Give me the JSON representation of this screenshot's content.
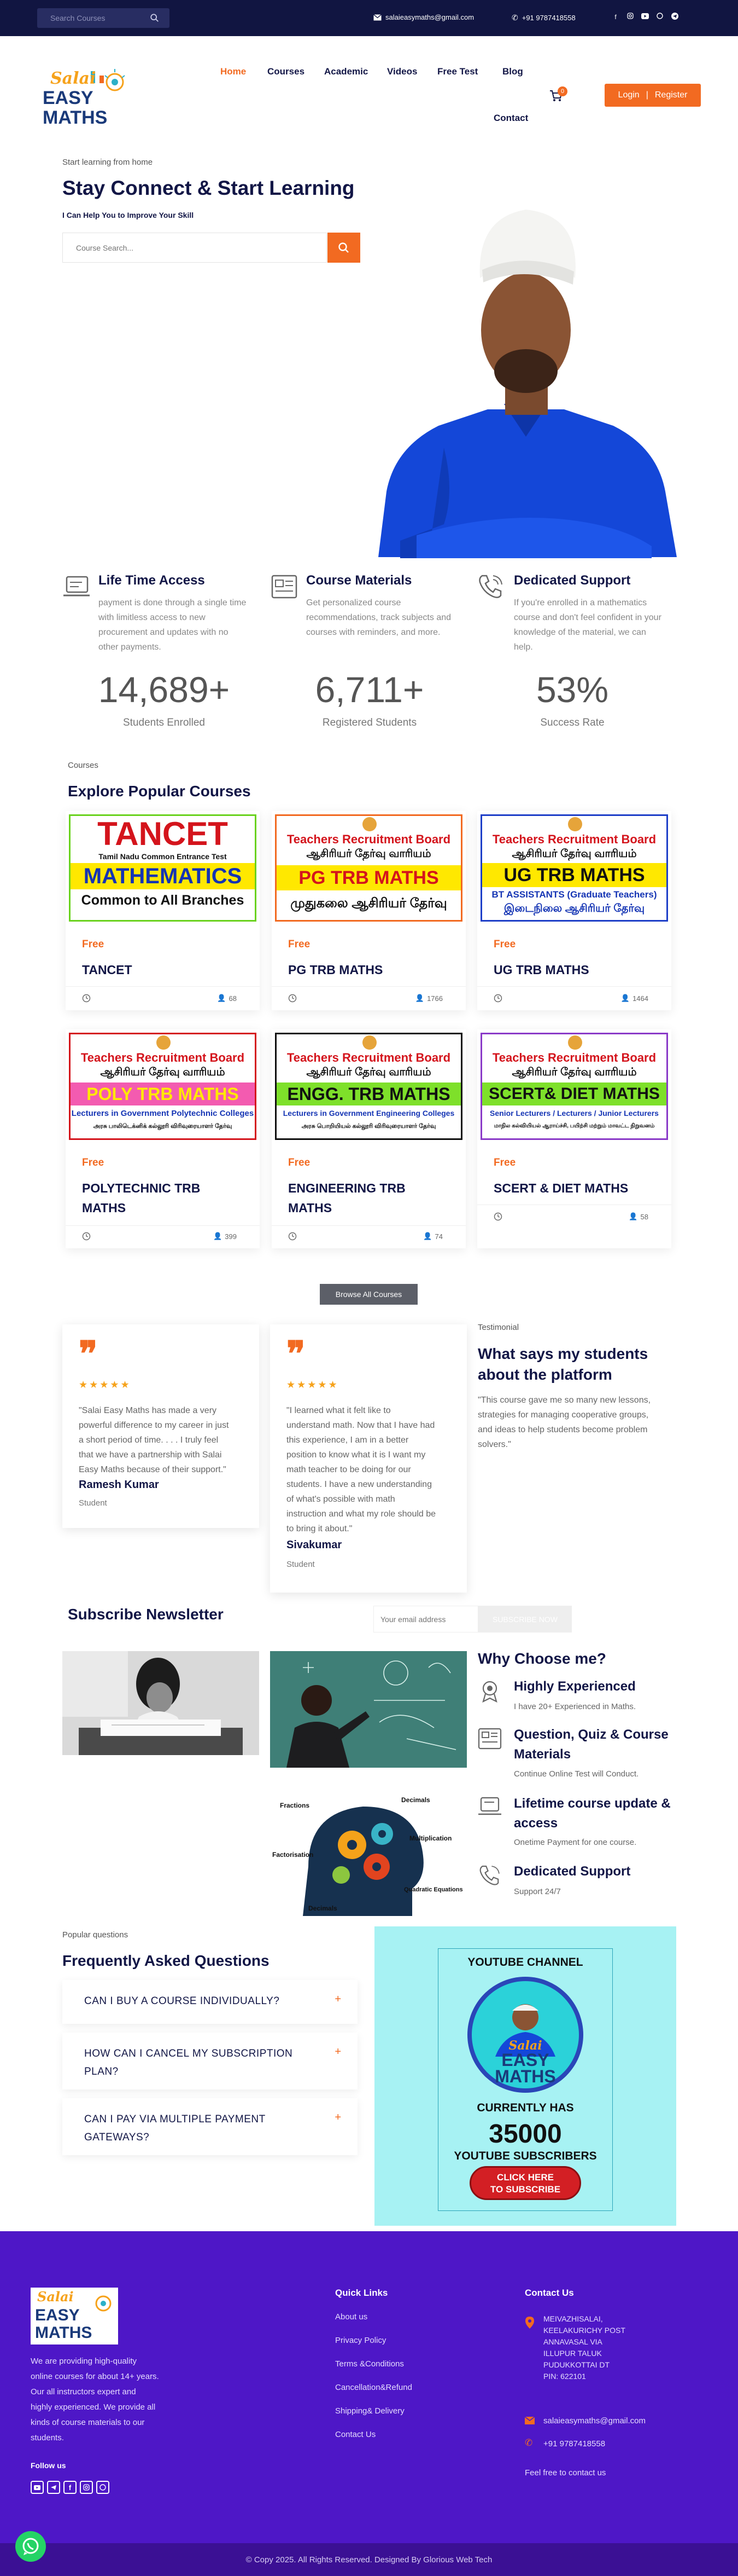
{
  "topbar": {
    "search_placeholder": "Search Courses",
    "email": "salaieasymaths@gmail.com",
    "phone": "+91 9787418558",
    "social_icons": [
      "facebook-icon",
      "instagram-icon",
      "youtube-icon",
      "whatsapp-icon",
      "telegram-icon"
    ]
  },
  "nav": {
    "logo_alt": "Salai Easy Maths",
    "logo_line1": "Salai",
    "logo_line2": "EASY",
    "logo_line3": "MATHS",
    "items": [
      "Home",
      "Courses",
      "Academic",
      "Videos",
      "Free Test",
      "Blog",
      "Contact"
    ],
    "cart_count": "0",
    "login": "Login",
    "register": "Register",
    "separator": "|"
  },
  "hero": {
    "kicker": "Start learning from home",
    "title": "Stay Connect & Start Learning",
    "subtitle": "I Can Help You to Improve Your Skill",
    "search_placeholder": "Course Search..."
  },
  "features": [
    {
      "title": "Life Time Access",
      "text": [
        "payment is done through a single time",
        "with limitless access to new",
        "procurement and updates with no",
        "other payments."
      ]
    },
    {
      "title": "Course Materials",
      "text": [
        "Get personalized course",
        "recommendations, track subjects and",
        "courses with reminders, and more."
      ]
    },
    {
      "title": "Dedicated Support",
      "text": [
        "If you're enrolled in a mathematics",
        "course and don't feel confident in your",
        "knowledge of the material, we can",
        "help."
      ]
    }
  ],
  "stats": [
    {
      "value": "14,689+",
      "label": "Students Enrolled"
    },
    {
      "value": "6,711+",
      "label": "Registered Students"
    },
    {
      "value": "53%",
      "label": "Success Rate"
    }
  ],
  "courses": {
    "kicker": "Courses",
    "title": "Explore Popular Courses",
    "browse": "Browse All Courses",
    "items": [
      {
        "price": "Free",
        "title": "TANCET",
        "students": "68",
        "banner": {
          "l1": "TANCET",
          "l2": "Tamil Nadu Common Entrance Test",
          "l3": "MATHEMATICS",
          "l4": "Common to All Branches"
        }
      },
      {
        "price": "Free",
        "title": "PG TRB MATHS",
        "students": "1766",
        "banner": {
          "l1": "Teachers Recruitment Board",
          "l2": "ஆசிரியர் தேர்வு வாரியம்",
          "l3": "PG TRB MATHS",
          "l4": "முதுகலை ஆசிரியர் தேர்வு"
        }
      },
      {
        "price": "Free",
        "title": "UG TRB MATHS",
        "students": "1464",
        "banner": {
          "l1": "Teachers Recruitment Board",
          "l2": "ஆசிரியர் தேர்வு வாரியம்",
          "l3": "UG TRB MATHS",
          "l4": "BT ASSISTANTS (Graduate Teachers)",
          "l5": "இடைநிலை ஆசிரியர் தேர்வு"
        }
      },
      {
        "price": "Free",
        "title": "POLYTECHNIC TRB MATHS",
        "students": "399",
        "banner": {
          "l1": "Teachers Recruitment Board",
          "l2": "ஆசிரியர் தேர்வு வாரியம்",
          "l3": "POLY TRB MATHS",
          "l4": "Lecturers in Government Polytechnic Colleges",
          "l5": "அரசு பாலிடெக்னிக் கல்லூரி விரிவுரையாளர் தேர்வு"
        }
      },
      {
        "price": "Free",
        "title": "ENGINEERING TRB MATHS",
        "students": "74",
        "banner": {
          "l1": "Teachers Recruitment Board",
          "l2": "ஆசிரியர் தேர்வு வாரியம்",
          "l3": "ENGG. TRB MATHS",
          "l4": "Lecturers in Government Engineering Colleges",
          "l5": "அரசு பொறியியல் கல்லூரி விரிவுரையாளர் தேர்வு"
        }
      },
      {
        "price": "Free",
        "title": "SCERT & DIET MATHS",
        "students": "58",
        "banner": {
          "l1": "Teachers Recruitment Board",
          "l2": "ஆசிரியர் தேர்வு வாரியம்",
          "l3": "SCERT& DIET MATHS",
          "l4": "Senior Lecturers / Lecturers / Junior Lecturers",
          "l5": "மாநில கல்வியியல் ஆராய்ச்சி, பயிற்சி மற்றும் மாவட்ட நிறுவனம்"
        }
      }
    ]
  },
  "testimonials": {
    "kicker": "Testimonial",
    "title": [
      "What says my students",
      "about the platform"
    ],
    "text": [
      "\"This course gave me so many new lessons,",
      "strategies for managing cooperative groups,",
      "and ideas to help students become problem",
      "solvers.\""
    ],
    "stars": "★★★★★",
    "quote_mark": "❞",
    "items": [
      {
        "quote": [
          "\"Salai Easy Maths has made a very",
          "powerful difference to my career in just",
          "a short period of time. . . . I truly feel",
          "that we have a partnership with Salai",
          "Easy Maths because of their support.\""
        ],
        "name": "Ramesh Kumar",
        "role": "Student"
      },
      {
        "quote": [
          "\"I learned what it felt like to",
          "understand math. Now that I have had",
          "this experience, I am in a better",
          "position to know what it is I want my",
          "math teacher to be doing for our",
          "students. I have a new understanding",
          "of what's possible with math",
          "instruction and what my role should be",
          "to bring it about.\""
        ],
        "name": "Sivakumar",
        "role": "Student"
      }
    ]
  },
  "newsletter": {
    "title": "Subscribe Newsletter",
    "placeholder": "Your email address",
    "button": "SUBSCRIBE NOW"
  },
  "why": {
    "title": "Why Choose me?",
    "items": [
      {
        "title": [
          "Highly Experienced"
        ],
        "text": "I have 20+ Experienced in Maths."
      },
      {
        "title": [
          "Question, Quiz & Course",
          "Materials"
        ],
        "text": "Continue Online Test will Conduct."
      },
      {
        "title": [
          "Lifetime course update &",
          "access"
        ],
        "text": "Onetime Payment for one course."
      },
      {
        "title": [
          "Dedicated Support"
        ],
        "text": "Support 24/7"
      }
    ],
    "board_labels": [
      "Fractions",
      "Decimals",
      "Multiplication",
      "Factorisation",
      "Quadratic Equations",
      "Decimals"
    ]
  },
  "faq": {
    "kicker": "Popular questions",
    "title": "Frequently Asked Questions",
    "items": [
      {
        "q": [
          "CAN I BUY A COURSE INDIVIDUALLY?"
        ]
      },
      {
        "q": [
          "HOW CAN I CANCEL MY SUBSCRIPTION",
          "PLAN?"
        ]
      },
      {
        "q": [
          "CAN I PAY VIA MULTIPLE PAYMENT",
          "GATEWAYS?"
        ]
      }
    ],
    "plus": "+"
  },
  "youtube": {
    "header": "YOUTUBE CHANNEL",
    "logo_line1": "Salai",
    "logo_line2": "EASY",
    "logo_line3": "MATHS",
    "currently": "CURRENTLY HAS",
    "count": "35000",
    "subscribers": "YOUTUBE SUBSCRIBERS",
    "cta1": "CLICK HERE",
    "cta2": "TO SUBSCRIBE"
  },
  "footer": {
    "about": [
      "We are providing high-quality",
      "online courses for about 14+ years.",
      "Our all instructors expert and",
      "highly experienced. We provide all",
      "kinds of course materials to our",
      "students."
    ],
    "follow": "Follow us",
    "quick_links_title": "Quick Links",
    "quick_links": [
      "About us",
      "Privacy Policy",
      "Terms &Conditions",
      "Cancellation&Refund",
      "Shipping& Delivery",
      "Contact Us"
    ],
    "contact_title": "Contact Us",
    "address": [
      "MEIVAZHISALAI,",
      "KEELAKURICHY POST",
      "ANNAVASAL VIA",
      "ILLUPUR TALUK",
      "PUDUKKOTTAI DT",
      "PIN: 622101"
    ],
    "email": "salaieasymaths@gmail.com",
    "phone": "+91 9787418558",
    "note": "Feel free to contact us",
    "copyright": "© Copy 2025. All Rights Reserved. Designed By Glorious Web Tech"
  },
  "colors": {
    "navy": "#121646",
    "orange": "#f26a21",
    "footer": "#4e17c7",
    "cyan": "#a7f2f3"
  }
}
